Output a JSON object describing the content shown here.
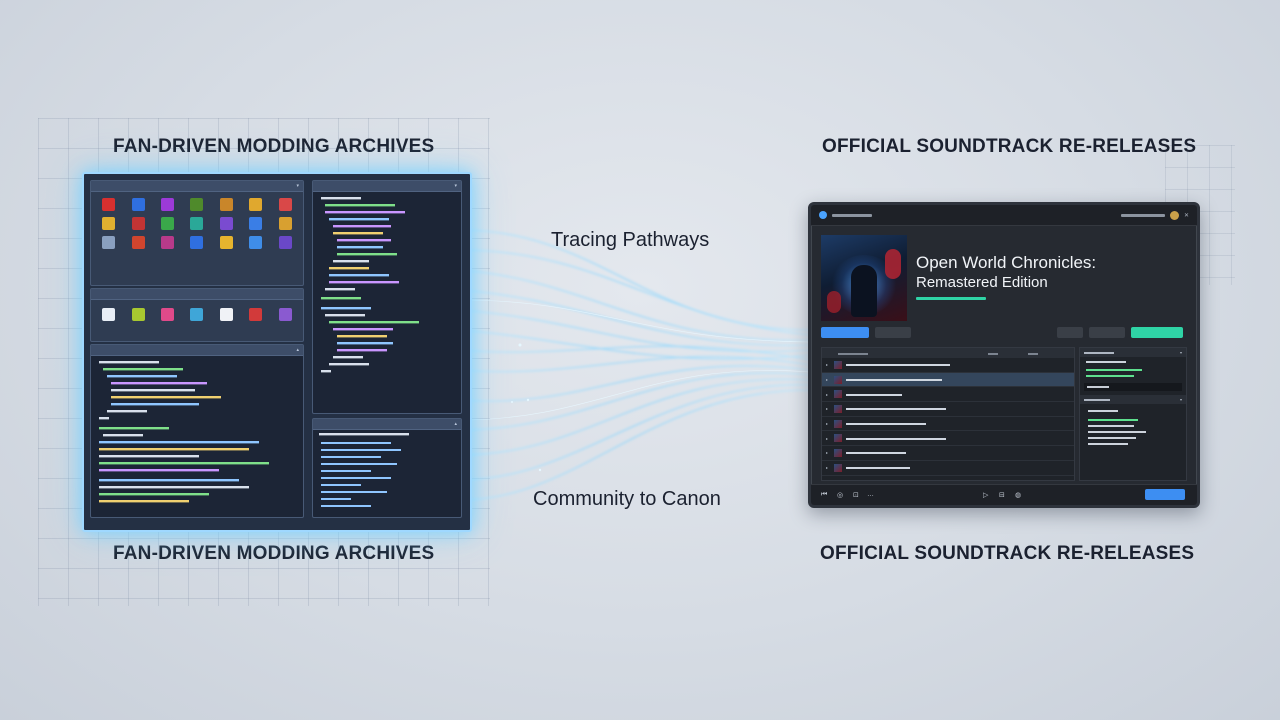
{
  "headings": {
    "left_top": "FAN-DRIVEN MODDING ARCHIVES",
    "left_bottom": "FAN-DRIVEN MODDING ARCHIVES",
    "right_top": "OFFICIAL SOUNDTRACK RE-RELEASES",
    "right_bottom": "OFFICIAL SOUNDTRACK RE-RELEASES"
  },
  "middle": {
    "label_top": "Tracing Pathways",
    "label_bottom": "Community to Canon"
  },
  "player": {
    "album_title_line1": "Open World Chronicles:",
    "album_title_line2": "Remastered Edition"
  },
  "colors": {
    "glow": "#9fd8ff",
    "stream": "#7fd3ff",
    "primary_button": "#3d8ef2",
    "accent_button": "#2fd4a6"
  }
}
